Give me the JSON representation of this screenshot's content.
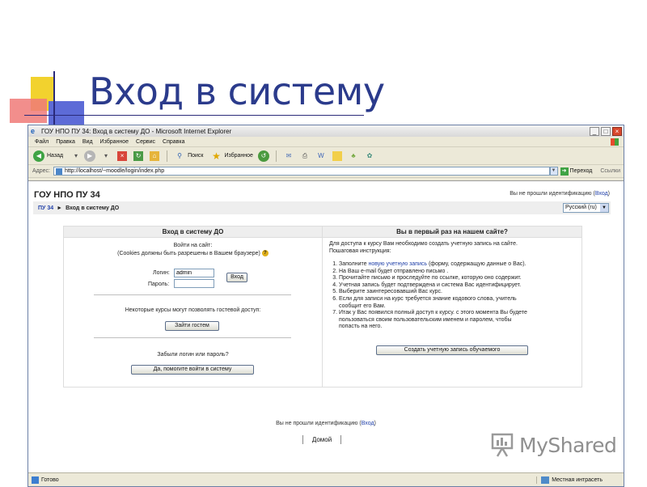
{
  "slide": {
    "title": "Вход в систему"
  },
  "window": {
    "title": "ГОУ НПО ПУ 34: Вход в систему ДО - Microsoft Internet Explorer"
  },
  "menu": [
    "Файл",
    "Правка",
    "Вид",
    "Избранное",
    "Сервис",
    "Справка"
  ],
  "toolbar": {
    "back": "Назад",
    "search": "Поиск",
    "favorites": "Избранное"
  },
  "address": {
    "label": "Адрес:",
    "url": "http://localhost/~moodle/login/index.php",
    "go": "Переход",
    "links": "Ссылки"
  },
  "page": {
    "site_name": "ГОУ НПО ПУ 34",
    "login_status_prefix": "Вы не прошли идентификацию (",
    "login_link": "Вход",
    "login_status_suffix": ")",
    "breadcrumb": {
      "home": "ПУ 34",
      "current": "Вход в систему ДО"
    },
    "language": "Русский (ru)"
  },
  "login": {
    "heading": "Вход в систему ДО",
    "intro_line1": "Войти на сайт:",
    "intro_line2": "(Cookies должны быть разрешены в Вашем браузере)",
    "username_label": "Логин:",
    "username_value": "admin",
    "password_label": "Пароль:",
    "submit": "Вход",
    "guest_text": "Некоторые курсы могут позволять гостевой доступ:",
    "guest_button": "Зайти гостем",
    "forgot_text": "Забыли логин или пароль?",
    "forgot_button": "Да, помогите войти в систему"
  },
  "signup": {
    "heading": "Вы в первый раз на нашем сайте?",
    "intro_line1": "Для доступа к курсу Вам необходимо создать учетную запись на сайте.",
    "intro_line2": "Пошаговая инструкция:",
    "step1_before": "Заполните ",
    "step1_link": "новую учетную запись",
    "step1_after": " (форму, содержащую данные о Вас).",
    "step2": "На Ваш e-mail будет отправлено письмо .",
    "step3": "Прочитайте письмо и проследуйте по ссылке, которую оно содержит.",
    "step4": "Учетная запись будет подтверждена и система Вас идентифицирует.",
    "step5": "Выберите заинтересовавший Вас курс.",
    "step6_line1": "Если для записи на курс требуется знание кодового слова, учитель",
    "step6_line2": "сообщит его Вам.",
    "step7_line1": "Итак у Вас появился полный доступ к курсу. с этого момента Вы будете",
    "step7_line2": "пользоваться своим пользовательским именем и паролем, чтобы",
    "step7_line3": "попасть на него.",
    "button": "Создать учетную запись обучаемого"
  },
  "footer": {
    "home_button": "Домой"
  },
  "status": {
    "text": "Готово",
    "zone": "Местная интрасеть"
  },
  "watermark": {
    "text": "MyShared"
  },
  "colors": {
    "title": "#2b3b8c",
    "link": "#1f3fa8"
  }
}
